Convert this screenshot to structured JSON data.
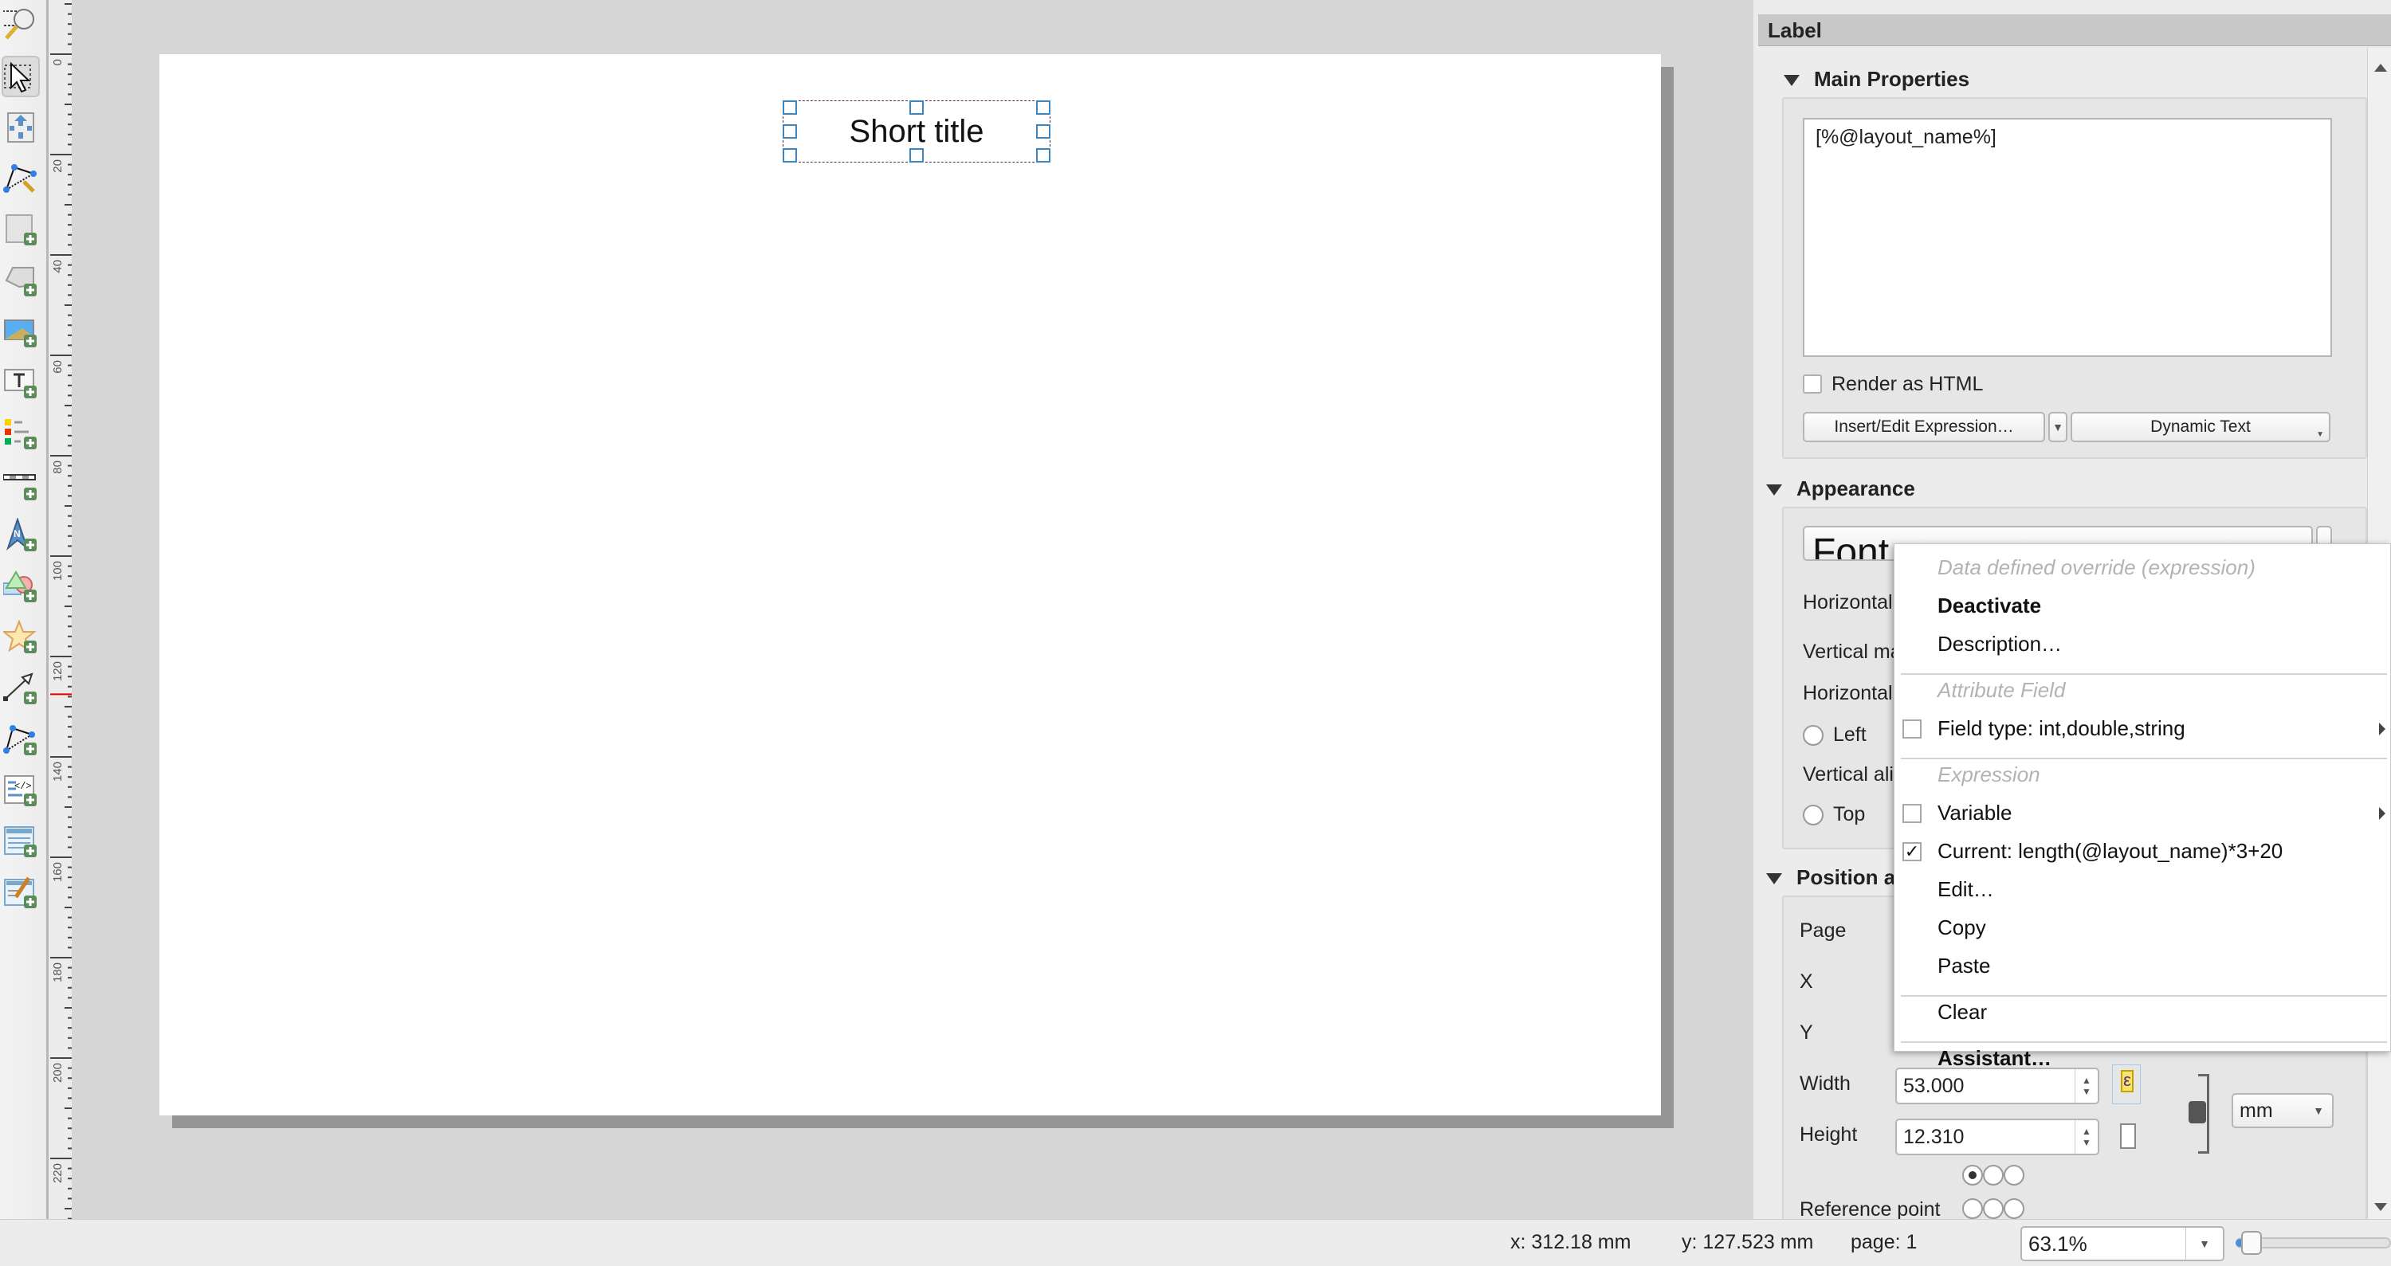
{
  "toolbar": {
    "tools": [
      {
        "name": "zoom-tool",
        "active": false
      },
      {
        "name": "select-move-item-tool",
        "active": true
      },
      {
        "name": "move-content-tool",
        "active": false
      },
      {
        "name": "edit-nodes-tool",
        "active": false
      },
      {
        "name": "add-map-tool",
        "active": false
      },
      {
        "name": "add-3d-map-tool",
        "active": false
      },
      {
        "name": "add-picture-tool",
        "active": false
      },
      {
        "name": "add-label-tool",
        "active": false
      },
      {
        "name": "add-legend-tool",
        "active": false
      },
      {
        "name": "add-scalebar-tool",
        "active": false
      },
      {
        "name": "add-north-arrow-tool",
        "active": false
      },
      {
        "name": "add-shape-tool",
        "active": false
      },
      {
        "name": "add-marker-tool",
        "active": false
      },
      {
        "name": "add-arrow-tool",
        "active": false
      },
      {
        "name": "add-node-item-tool",
        "active": false
      },
      {
        "name": "add-html-tool",
        "active": false
      },
      {
        "name": "add-attribute-table-tool",
        "active": false
      },
      {
        "name": "add-fixed-table-tool",
        "active": false
      }
    ]
  },
  "ruler": {
    "labels": [
      "0",
      "20",
      "40",
      "60",
      "80",
      "100",
      "120",
      "140",
      "160",
      "180",
      "200",
      "220"
    ],
    "cursor_mark": "127.523"
  },
  "canvas": {
    "label_item_text": "Short title"
  },
  "panel": {
    "title": "Label",
    "main_properties": {
      "heading": "Main Properties",
      "text_value": "[%@layout_name%]",
      "render_html_label": "Render as HTML",
      "render_html_checked": false,
      "insert_expression_label": "Insert/Edit Expression…",
      "dynamic_text_label": "Dynamic Text"
    },
    "appearance": {
      "heading": "Appearance",
      "font_button_label": "Font",
      "horizontal_margin_label": "Horizontal margin",
      "vertical_margin_label": "Vertical margin",
      "horizontal_alignment_label": "Horizontal alignment",
      "halign_left": "Left",
      "vertical_alignment_label": "Vertical alignment",
      "valign_top": "Top"
    },
    "position": {
      "heading": "Position and Size",
      "page_label": "Page",
      "x_label": "X",
      "y_label": "Y",
      "width_label": "Width",
      "width_value": "53.000",
      "height_label": "Height",
      "height_value": "12.310",
      "unit": "mm",
      "reference_point_label": "Reference point",
      "reference_point_selected": "top-left"
    }
  },
  "context_menu": {
    "items": [
      {
        "type": "header",
        "label": "Data defined override (expression)"
      },
      {
        "type": "item",
        "label": "Deactivate",
        "bold": true
      },
      {
        "type": "item",
        "label": "Description…"
      },
      {
        "type": "separator"
      },
      {
        "type": "header",
        "label": "Attribute Field"
      },
      {
        "type": "check",
        "label": "Field type: int,double,string",
        "checked": false,
        "submenu": true
      },
      {
        "type": "separator"
      },
      {
        "type": "header",
        "label": "Expression"
      },
      {
        "type": "check",
        "label": "Variable",
        "checked": false,
        "submenu": true
      },
      {
        "type": "check",
        "label": "Current: length(@layout_name)*3+20",
        "checked": true
      },
      {
        "type": "item",
        "label": "Edit…"
      },
      {
        "type": "item",
        "label": "Copy"
      },
      {
        "type": "item",
        "label": "Paste"
      },
      {
        "type": "separator"
      },
      {
        "type": "item",
        "label": "Clear"
      },
      {
        "type": "separator"
      },
      {
        "type": "item",
        "label": "Assistant…",
        "bold": true
      }
    ]
  },
  "status_bar": {
    "x_readout": "x: 312.18 mm",
    "y_readout": "y: 127.523 mm",
    "page_readout": "page: 1",
    "zoom_value": "63.1%",
    "zoom_slider_fraction": 0.04
  },
  "colors": {
    "selection_handle": "#3d86c0",
    "ruler_cursor": "#e00000",
    "dd_active_yellow": "#f5e56b"
  }
}
